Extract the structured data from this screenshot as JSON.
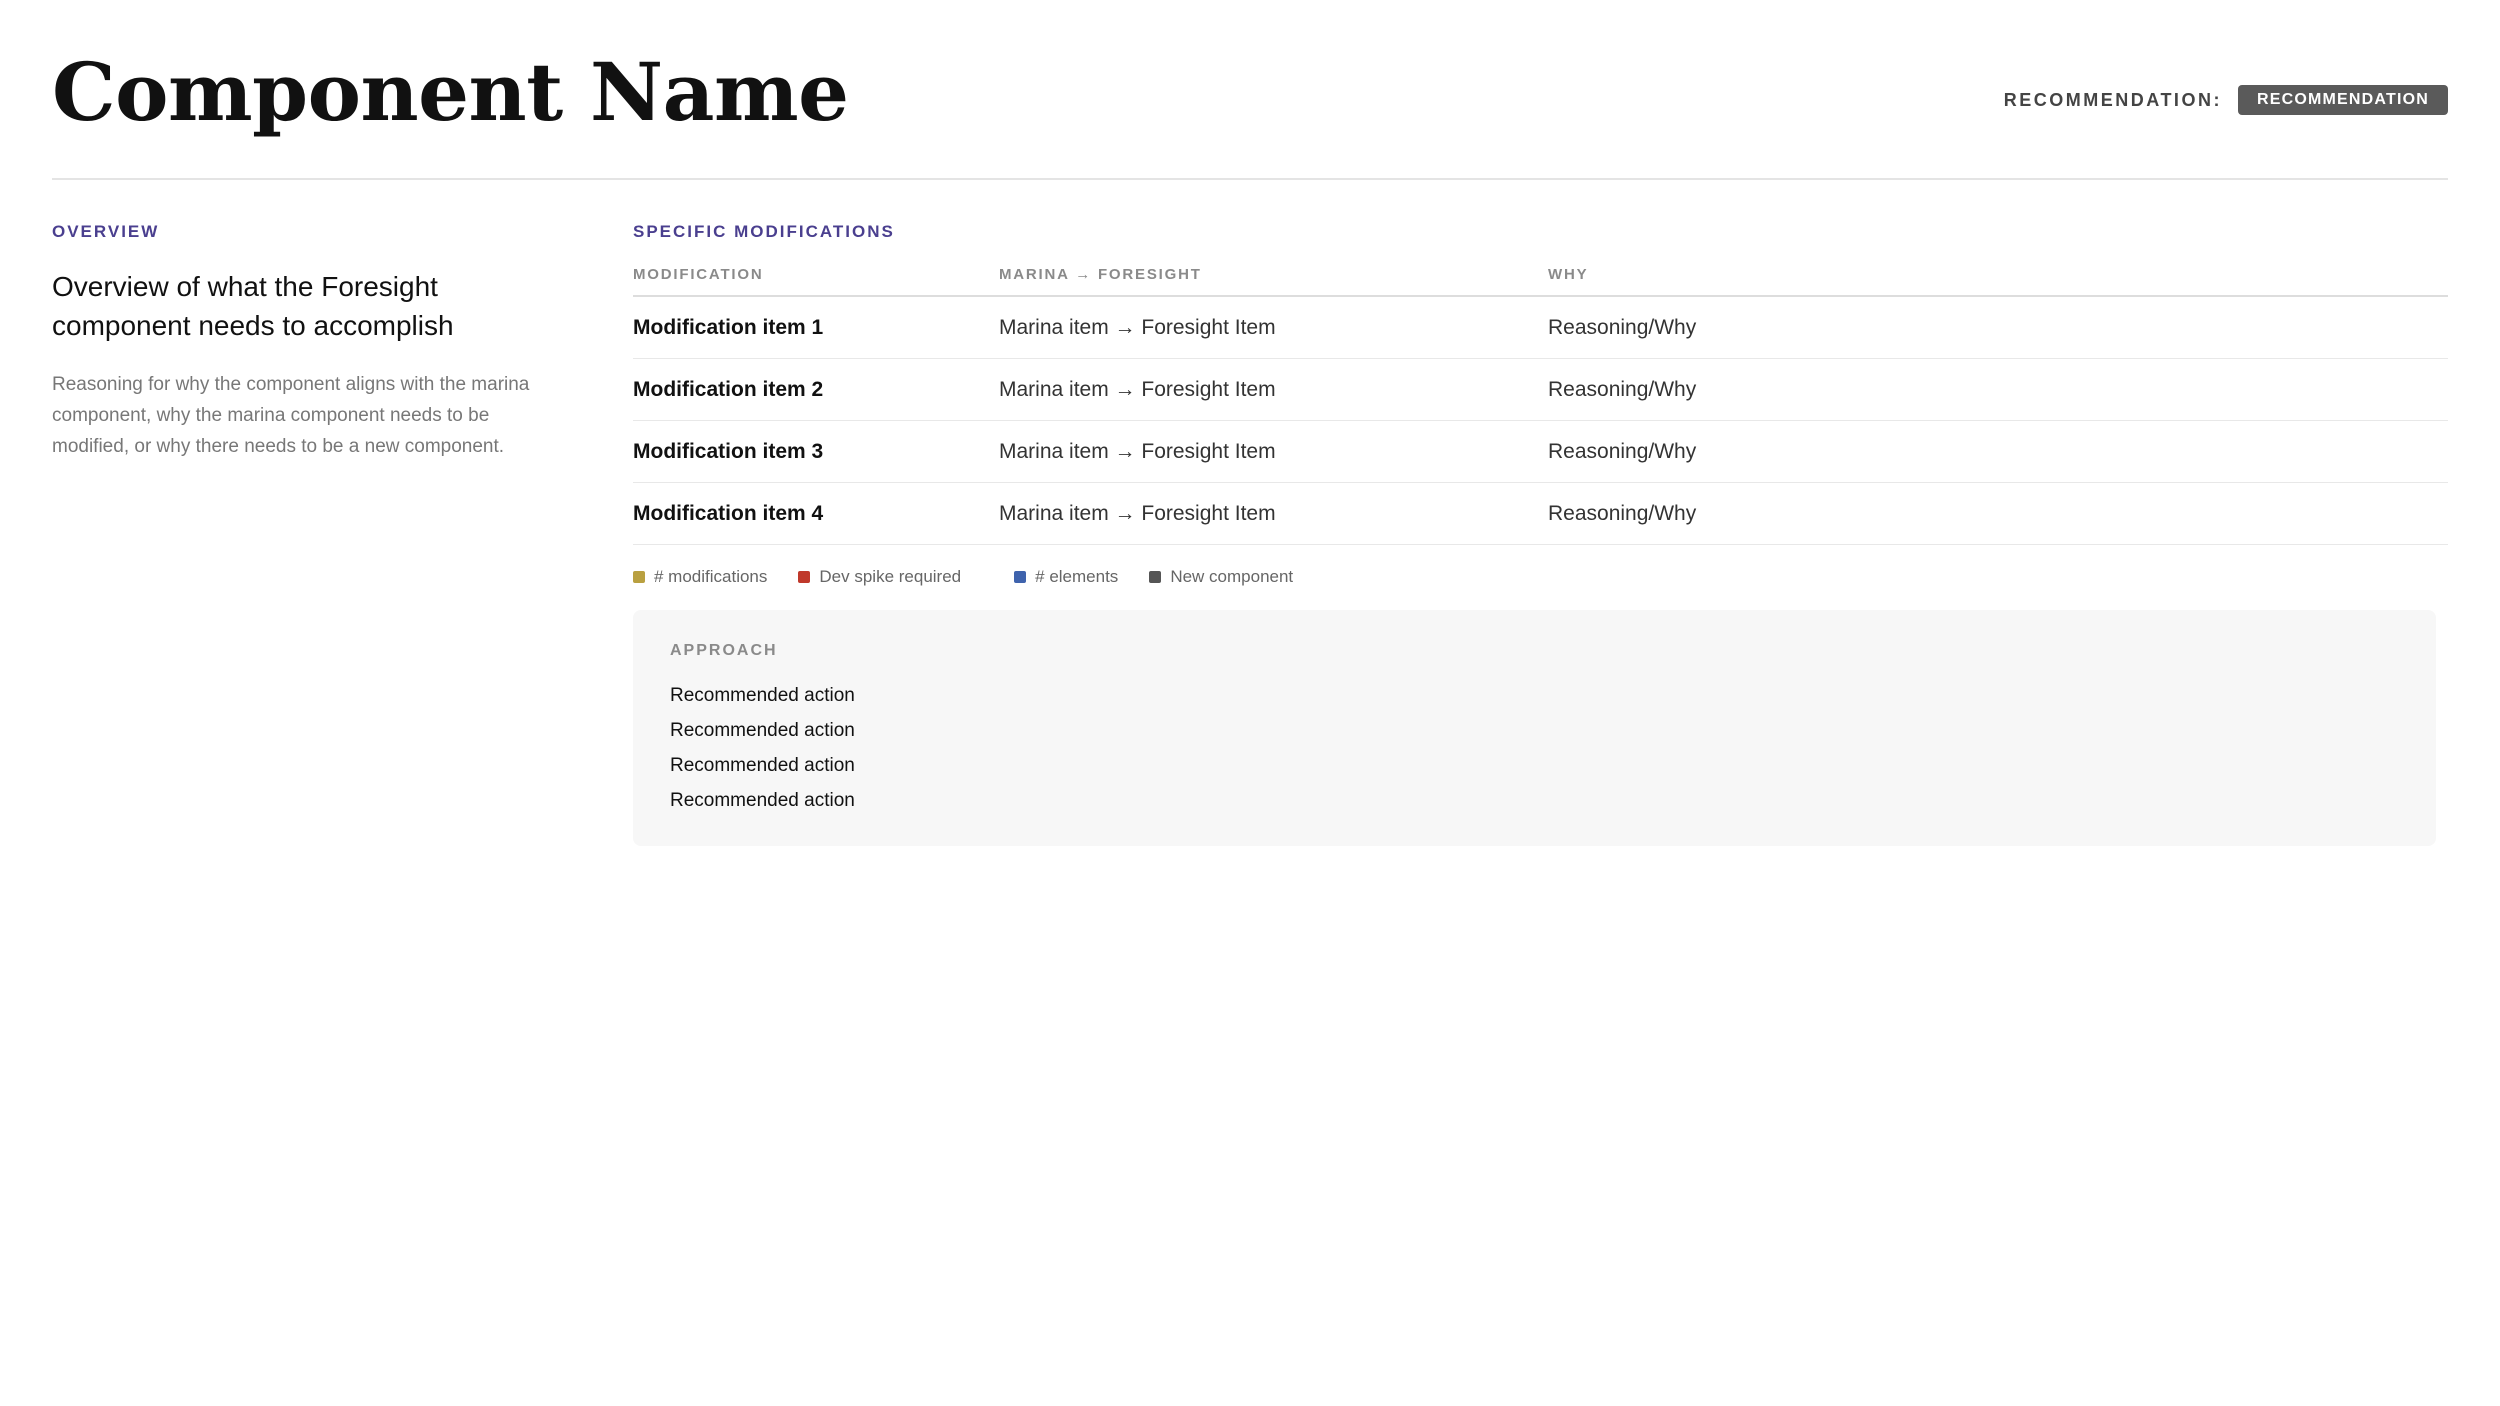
{
  "header": {
    "title": "Component Name",
    "recommendation_label": "RECOMMENDATION:",
    "recommendation_badge": "RECOMMENDATION"
  },
  "overview": {
    "label": "OVERVIEW",
    "heading": "Overview of what the Foresight component needs to accomplish",
    "body": "Reasoning for why the component aligns with the marina component, why the marina component needs to be modified, or why there needs to be a new component."
  },
  "modifications": {
    "label": "SPECIFIC MODIFICATIONS",
    "columns": [
      "MODIFICATION",
      "MARINA → FORESIGHT",
      "WHY"
    ],
    "rows": [
      {
        "name": "Modification item 1",
        "mapping": "Marina item → Foresight Item",
        "why": "Reasoning/Why"
      },
      {
        "name": "Modification item 2",
        "mapping": "Marina item → Foresight Item",
        "why": "Reasoning/Why"
      },
      {
        "name": "Modification item 3",
        "mapping": "Marina item → Foresight Item",
        "why": "Reasoning/Why"
      },
      {
        "name": "Modification item 4",
        "mapping": "Marina item → Foresight Item",
        "why": "Reasoning/Why"
      }
    ]
  },
  "legend": [
    {
      "label": "# modifications",
      "color": "#b9a040"
    },
    {
      "label": "Dev spike required",
      "color": "#c0392b"
    },
    {
      "label": "# elements",
      "color": "#3f63ad"
    },
    {
      "label": "New component",
      "color": "#555555"
    }
  ],
  "approach": {
    "label": "APPROACH",
    "items": [
      "Recommended action",
      "Recommended action",
      "Recommended action",
      "Recommended action"
    ]
  },
  "colors": {
    "accent": "#4a3f8f",
    "badge_bg": "#5a5a5a",
    "divider": "#e4e4e4",
    "approach_bg": "#f7f7f7"
  }
}
